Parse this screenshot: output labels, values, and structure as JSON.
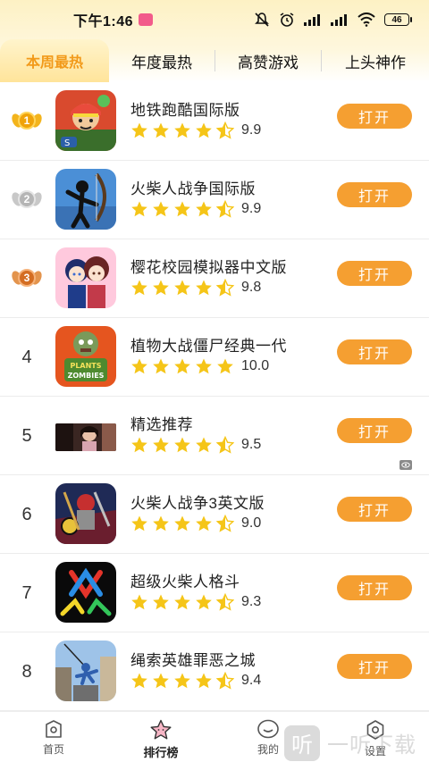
{
  "status_bar": {
    "time": "下午1:46",
    "battery": "46"
  },
  "tabs": [
    {
      "label": "本周最热",
      "active": true
    },
    {
      "label": "年度最热",
      "active": false
    },
    {
      "label": "高赞游戏",
      "active": false
    },
    {
      "label": "上头神作",
      "active": false
    }
  ],
  "games": [
    {
      "rank": "1",
      "medal": "gold",
      "title": "地铁跑酷国际版",
      "score": "9.9",
      "stars": 4.5,
      "icon": "subway-surfers-icon",
      "open_label": "打开"
    },
    {
      "rank": "2",
      "medal": "silver",
      "title": "火柴人战争国际版",
      "score": "9.9",
      "stars": 4.5,
      "icon": "stick-war-icon",
      "open_label": "打开"
    },
    {
      "rank": "3",
      "medal": "bronze",
      "title": "樱花校园模拟器中文版",
      "score": "9.8",
      "stars": 4.5,
      "icon": "sakura-school-icon",
      "open_label": "打开"
    },
    {
      "rank": "4",
      "medal": "",
      "title": "植物大战僵尸经典一代",
      "score": "10.0",
      "stars": 5,
      "icon": "plants-vs-zombies-icon",
      "open_label": "打开"
    },
    {
      "rank": "5",
      "medal": "",
      "title": "精选推荐",
      "score": "9.5",
      "stars": 4.5,
      "icon": "featured-thumbnail",
      "open_label": "打开"
    },
    {
      "rank": "6",
      "medal": "",
      "title": "火柴人战争3英文版",
      "score": "9.0",
      "stars": 4.5,
      "icon": "stick-war-3-icon",
      "open_label": "打开"
    },
    {
      "rank": "7",
      "medal": "",
      "title": "超级火柴人格斗",
      "score": "9.3",
      "stars": 4.5,
      "icon": "stickman-fight-icon",
      "open_label": "打开"
    },
    {
      "rank": "8",
      "medal": "",
      "title": "绳索英雄罪恶之城",
      "score": "9.4",
      "stars": 4.5,
      "icon": "rope-hero-icon",
      "open_label": "打开"
    }
  ],
  "bottom_nav": [
    {
      "label": "首页",
      "icon": "home-icon",
      "active": false
    },
    {
      "label": "排行榜",
      "icon": "ranking-star-icon",
      "active": true
    },
    {
      "label": "我的",
      "icon": "profile-icon",
      "active": false
    },
    {
      "label": "设置",
      "icon": "settings-icon",
      "active": false
    }
  ],
  "watermark": {
    "logo": "听",
    "text": "一听下载"
  },
  "colors": {
    "accent": "#f59f31",
    "active_tab": "#f29a1a",
    "star": "#f5c518"
  }
}
